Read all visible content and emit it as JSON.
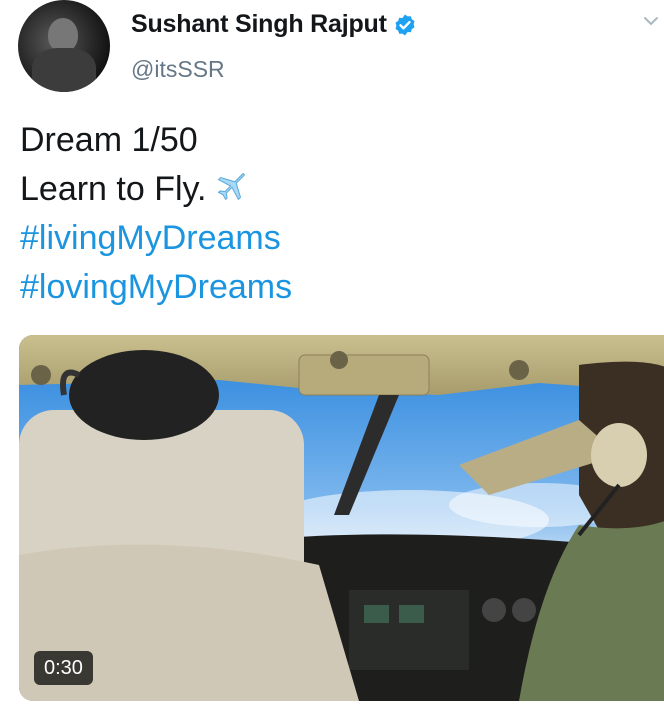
{
  "user": {
    "display_name": "Sushant Singh Rajput",
    "handle": "@itsSSR",
    "avatar_icon": "avatar",
    "verified_icon": "verified-badge-icon"
  },
  "tweet": {
    "line1": "Dream 1/50",
    "line2": "Learn to Fly.",
    "emoji_icon": "airplane-icon",
    "hashtag1": "#livingMyDreams",
    "hashtag2": "#lovingMyDreams"
  },
  "media": {
    "type": "video",
    "duration": "0:30"
  },
  "colors": {
    "link": "#1b95e0",
    "text": "#14171a",
    "secondary": "#657786",
    "verified": "#1da1f2"
  }
}
